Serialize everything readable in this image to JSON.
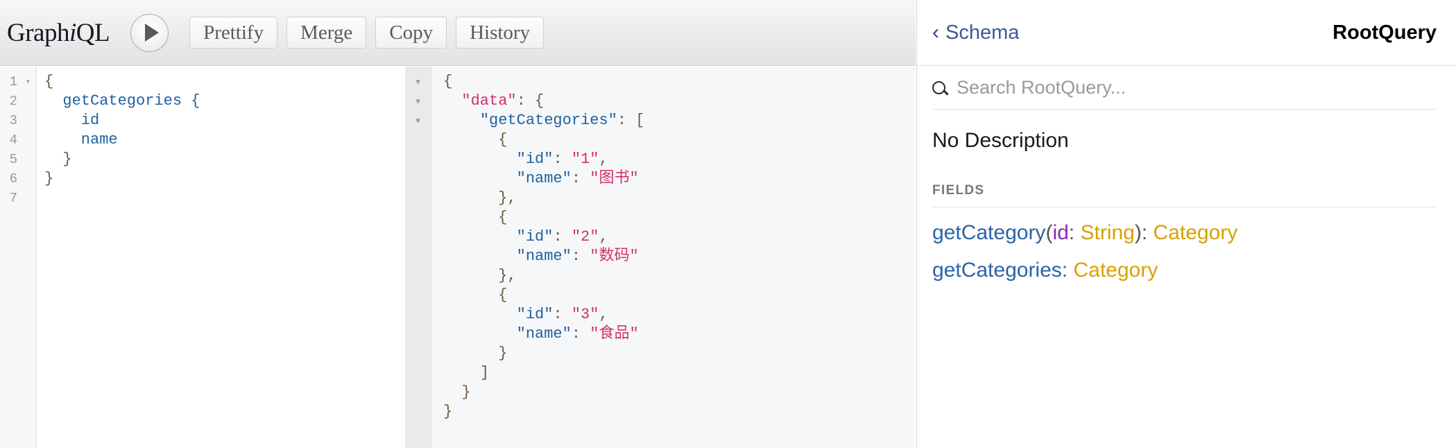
{
  "toolbar": {
    "brand_pre": "Graph",
    "brand_i": "i",
    "brand_post": "QL",
    "execute_label": "execute-query",
    "buttons": [
      {
        "label": "Prettify",
        "name": "prettify-button"
      },
      {
        "label": "Merge",
        "name": "merge-button"
      },
      {
        "label": "Copy",
        "name": "copy-button"
      },
      {
        "label": "History",
        "name": "history-button"
      }
    ]
  },
  "query_editor": {
    "line_numbers": [
      "1",
      "2",
      "3",
      "4",
      "5",
      "6",
      "7"
    ],
    "fold_caret": "▾",
    "lines": [
      "{",
      "  getCategories {",
      "    id",
      "    name",
      "  }",
      "}",
      ""
    ],
    "text": "{\n  getCategories {\n    id\n    name\n  }\n}\n"
  },
  "result_viewer": {
    "fold_carets": [
      "▾",
      "▾",
      "▾"
    ],
    "data_key": "\"data\"",
    "root_field": "\"getCategories\"",
    "items": [
      {
        "id_key": "\"id\"",
        "id_value": "\"1\"",
        "name_key": "\"name\"",
        "name_value": "\"图书\""
      },
      {
        "id_key": "\"id\"",
        "id_value": "\"2\"",
        "name_key": "\"name\"",
        "name_value": "\"数码\""
      },
      {
        "id_key": "\"id\"",
        "id_value": "\"3\"",
        "name_key": "\"name\"",
        "name_value": "\"食品\""
      }
    ]
  },
  "docs": {
    "back_label": "Schema",
    "back_chevron": "‹",
    "title": "RootQuery",
    "search_placeholder": "Search RootQuery...",
    "search_value": "",
    "description": "No Description",
    "fields_heading": "FIELDS",
    "fields": [
      {
        "name": "getCategory",
        "open_paren": "(",
        "arg_name": "id",
        "arg_sep": ": ",
        "arg_type": "String",
        "close_paren": ")",
        "ret_sep": ": ",
        "return_type": "Category"
      },
      {
        "name": "getCategories",
        "open_paren": "",
        "arg_name": "",
        "arg_sep": "",
        "arg_type": "",
        "close_paren": "",
        "ret_sep": ": ",
        "return_type": "Category"
      }
    ]
  },
  "colors": {
    "brand_text": "#141823",
    "link_blue": "#2a63a8",
    "type_gold": "#d8a000",
    "arg_purple": "#8b2bb9",
    "json_key_blue": "#1f61a0",
    "json_string_pink": "#d4306d",
    "toolbar_bg": "#e2e2e2",
    "result_bg": "#f6f7f8"
  }
}
